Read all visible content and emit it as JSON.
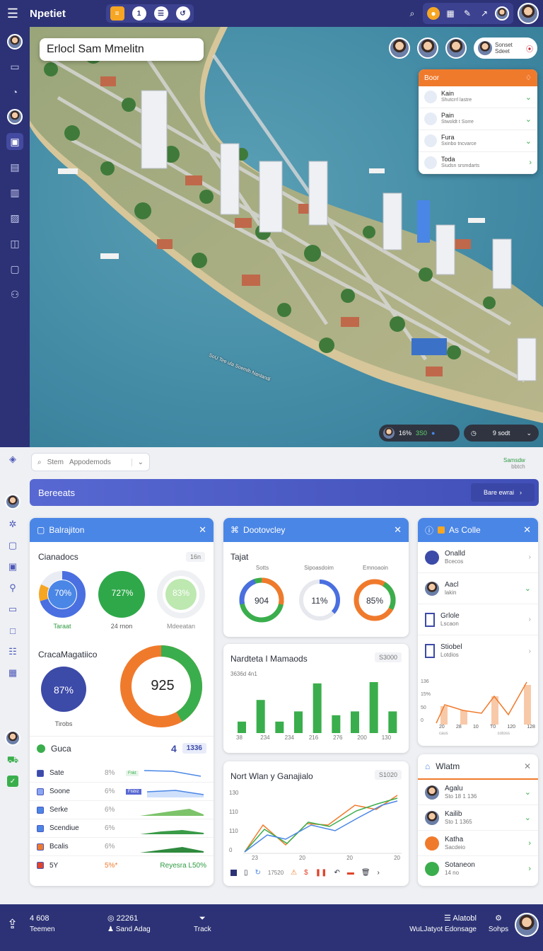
{
  "app": {
    "title": "Npetiet"
  },
  "topbar": {
    "tools": [
      "≡",
      "1",
      "☰",
      "↺"
    ],
    "menu_icon": "hamburger-icon"
  },
  "map": {
    "search_text": "Erlocl Sam Mmelitn",
    "user_pill": {
      "line1": "Sonset",
      "line2": "Sdeet"
    },
    "list_card": {
      "title": "Boor",
      "rows": [
        {
          "name": "Kain",
          "sub": "Shutcrrl lastre"
        },
        {
          "name": "Pain",
          "sub": "Stwoldt t Sorre"
        },
        {
          "name": "Fura",
          "sub": "Sxinbo tncvarce"
        },
        {
          "name": "Toda",
          "sub": "Siudsn srsmdarts"
        }
      ]
    },
    "stat1": {
      "pct": "16%",
      "val": "3S0"
    },
    "stat2": {
      "label": "9 sodt"
    },
    "water_label": "SoU Tee ula\nSoemlh Nanlandi"
  },
  "search": {
    "placeholder": "Stem",
    "value": "Appodemods"
  },
  "corner_status": {
    "line1": "Samsdw",
    "line2": "bbtch"
  },
  "banner": {
    "title": "Bereeats",
    "button": "Bare ewrai"
  },
  "cards": {
    "bal": {
      "title": "Balrajiton",
      "sec1": "Cianadocs",
      "sec1_badge": "16n",
      "donuts": [
        {
          "value": "70%",
          "label": "Taraat"
        },
        {
          "value": "727%",
          "label": "24 rnon"
        },
        {
          "value": "83%",
          "label": "Mdeeatan"
        }
      ],
      "sec2": "CracaMagatiico",
      "big_circle": "87%",
      "big_circle_label": "Tirobs",
      "big_donut": "925",
      "mini_title": "Guca",
      "mini_value": "4",
      "mini_badge": "1336",
      "rows": [
        {
          "name": "Sate",
          "pct": "8%",
          "tag": "Fnkt"
        },
        {
          "name": "Soone",
          "pct": "6%",
          "tag": "Fisbiz"
        },
        {
          "name": "Serke",
          "pct": "6%"
        },
        {
          "name": "Scendiue",
          "pct": "6%"
        },
        {
          "name": "Bcalis",
          "pct": "6%"
        }
      ],
      "footer_name": "5Y",
      "footer_pct": "5%*",
      "footer_right": "Reyesra L50%"
    },
    "dev": {
      "title": "Dootovcley",
      "sec": "Tajat",
      "cols": [
        "Sotts",
        "Sipoasdoim",
        "Emnoaoin"
      ],
      "donuts": [
        "904",
        "11%",
        "85%"
      ]
    },
    "bars": {
      "title": "Nardteta I Mamaods",
      "badge": "S3000",
      "sub": "3636d 4n1",
      "x_labels": [
        "38",
        "234",
        "234",
        "216",
        "276",
        "200",
        "130"
      ]
    },
    "lines": {
      "title": "Nort Wlan y Ganajialo",
      "badge": "S1020",
      "y_labels": [
        "130",
        "110",
        "110",
        "0"
      ],
      "x_labels": [
        "23",
        "20",
        "20",
        "20"
      ],
      "tool_value": "17520"
    },
    "asc": {
      "title": "As Colle",
      "rows": [
        {
          "name": "Onalld",
          "sub": "Bcecos"
        },
        {
          "name": "Aacl",
          "sub": "lakin"
        },
        {
          "name": "Grlole",
          "sub": "Lscaon"
        },
        {
          "name": "Stiobel",
          "sub": "Lotdios"
        }
      ],
      "y_labels": [
        "136",
        "15%",
        "50",
        "0"
      ],
      "x_labels": [
        "20",
        "28",
        "10",
        "T0",
        "120",
        "128"
      ],
      "x_sub": [
        "caus",
        "",
        "",
        "cotoss",
        "",
        ""
      ]
    },
    "watm": {
      "title": "Wlatm",
      "rows": [
        {
          "name": "Agalu",
          "sub": "Sto 18 1 136"
        },
        {
          "name": "Kailib",
          "sub": "Sto 1 1365"
        },
        {
          "name": "Katha",
          "sub": "Sacdeio"
        },
        {
          "name": "Sotaneon",
          "sub": "14 no"
        }
      ]
    }
  },
  "bottom": {
    "left_value": "4 608",
    "left_label": "Teemen",
    "mid_value": "22261",
    "mid_label": "Sand Adag",
    "track_label": "Track",
    "right1_value": "Alatobl",
    "right1_label": "WuLJatyot Edonsage",
    "right2_label": "Sohps"
  },
  "colors": {
    "navy": "#2c3275",
    "blue": "#4a86e6",
    "green": "#3aae4c",
    "orange": "#f07a2c"
  }
}
